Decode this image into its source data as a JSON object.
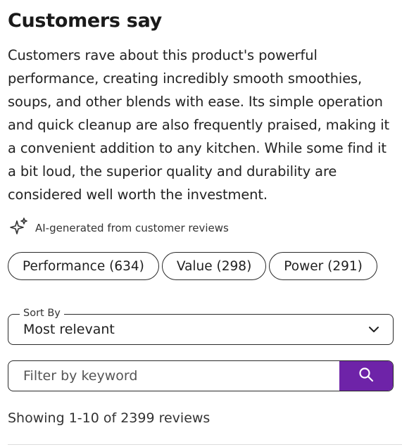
{
  "header": {
    "title": "Customers say"
  },
  "summary": {
    "text": "Customers rave about this product's powerful performance, creating incredibly smooth smoothies, soups, and other blends with ease. Its simple operation and quick cleanup are also frequently praised, making it a convenient addition to any kitchen. While some find it a bit loud, the superior quality and durability are considered well worth the investment.",
    "ai_note": "AI-generated from customer reviews",
    "ai_icon": "sparkle-icon"
  },
  "chips": [
    {
      "label": "Performance (634)"
    },
    {
      "label": "Value (298)"
    },
    {
      "label": "Power (291)"
    }
  ],
  "sort": {
    "label": "Sort By",
    "value": "Most relevant",
    "icon": "chevron-down-icon"
  },
  "filter": {
    "placeholder": "Filter by keyword",
    "value": "",
    "button_icon": "search-icon",
    "button_color": "#6e23a8"
  },
  "results": {
    "showing": "Showing 1-10 of 2399 reviews"
  }
}
